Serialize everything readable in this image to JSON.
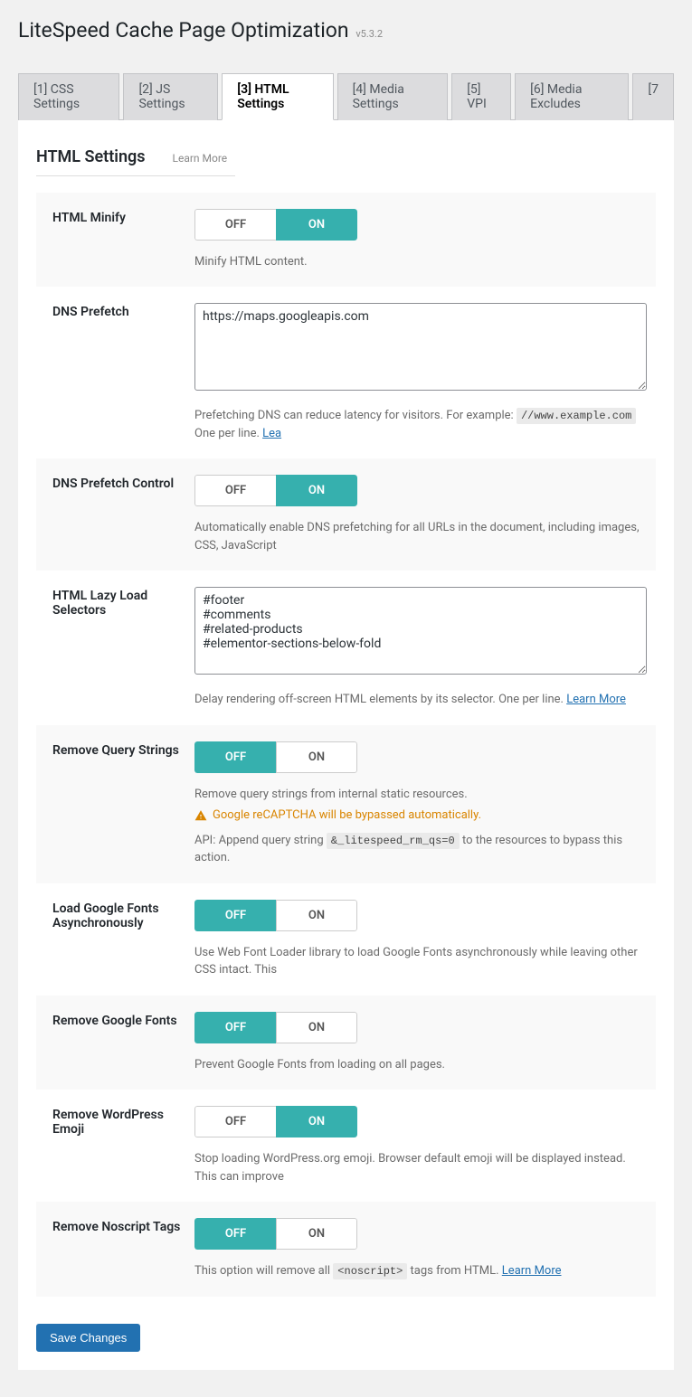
{
  "page": {
    "title": "LiteSpeed Cache Page Optimization",
    "version": "v5.3.2"
  },
  "tabs": [
    "[1] CSS Settings",
    "[2] JS Settings",
    "[3] HTML Settings",
    "[4] Media Settings",
    "[5] VPI",
    "[6] Media Excludes",
    "[7"
  ],
  "active_tab_index": 2,
  "section": {
    "title": "HTML Settings",
    "learn": "Learn More"
  },
  "toggle_labels": {
    "off": "OFF",
    "on": "ON"
  },
  "rows": {
    "html_minify": {
      "label": "HTML Minify",
      "value": "on",
      "desc": "Minify HTML content."
    },
    "dns_prefetch": {
      "label": "DNS Prefetch",
      "value": "https://maps.googleapis.com",
      "desc_pre": "Prefetching DNS can reduce latency for visitors. For example: ",
      "desc_code": "//www.example.com",
      "desc_mid": " One per line. ",
      "desc_link": "Lea"
    },
    "dns_prefetch_control": {
      "label": "DNS Prefetch Control",
      "value": "on",
      "desc": "Automatically enable DNS prefetching for all URLs in the document, including images, CSS, JavaScript"
    },
    "html_lazy_load": {
      "label": "HTML Lazy Load Selectors",
      "value": "#footer\n#comments\n#related-products\n#elementor-sections-below-fold",
      "desc_pre": "Delay rendering off-screen HTML elements by its selector. One per line. ",
      "desc_link": "Learn More"
    },
    "remove_query_strings": {
      "label": "Remove Query Strings",
      "value": "off",
      "desc1": "Remove query strings from internal static resources.",
      "warn": "Google reCAPTCHA will be bypassed automatically.",
      "api_pre": "API: Append query string ",
      "api_code": "&_litespeed_rm_qs=0",
      "api_post": " to the resources to bypass this action."
    },
    "load_google_fonts_async": {
      "label": "Load Google Fonts Asynchronously",
      "value": "off",
      "desc": "Use Web Font Loader library to load Google Fonts asynchronously while leaving other CSS intact. This"
    },
    "remove_google_fonts": {
      "label": "Remove Google Fonts",
      "value": "off",
      "desc": "Prevent Google Fonts from loading on all pages."
    },
    "remove_wp_emoji": {
      "label": "Remove WordPress Emoji",
      "value": "on",
      "desc": "Stop loading WordPress.org emoji. Browser default emoji will be displayed instead. This can improve"
    },
    "remove_noscript": {
      "label": "Remove Noscript Tags",
      "value": "off",
      "desc_pre": "This option will remove all ",
      "desc_code": "<noscript>",
      "desc_mid": " tags from HTML. ",
      "desc_link": "Learn More"
    }
  },
  "save_button": "Save Changes"
}
